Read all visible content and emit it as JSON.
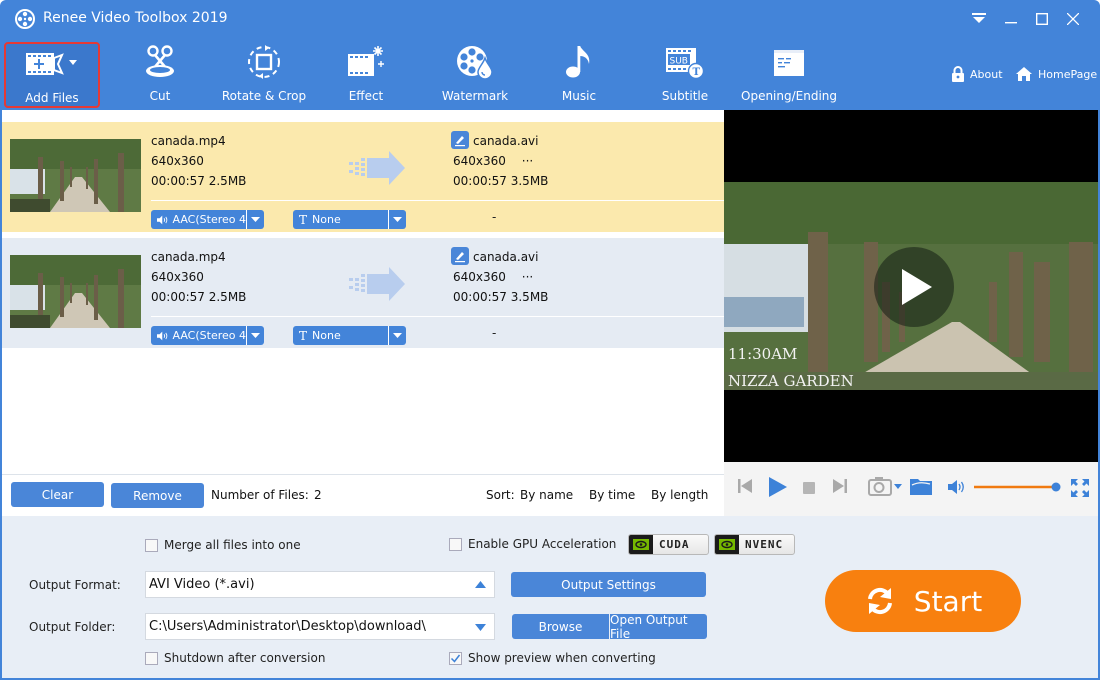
{
  "window": {
    "title": "Renee Video Toolbox 2019",
    "controls": [
      "menu",
      "minimize",
      "maximize",
      "close"
    ]
  },
  "toolbar": {
    "items": [
      {
        "label": "Add Files",
        "icon": "add-film-icon",
        "active": true
      },
      {
        "label": "Cut",
        "icon": "scissors-icon"
      },
      {
        "label": "Rotate & Crop",
        "icon": "rotate-crop-icon"
      },
      {
        "label": "Effect",
        "icon": "effect-film-icon"
      },
      {
        "label": "Watermark",
        "icon": "watermark-reel-icon"
      },
      {
        "label": "Music",
        "icon": "music-note-icon"
      },
      {
        "label": "Subtitle",
        "icon": "subtitle-icon"
      },
      {
        "label": "Opening/Ending",
        "icon": "opening-ending-icon"
      }
    ],
    "about_label": "About",
    "homepage_label": "HomePage"
  },
  "files": [
    {
      "source_name": "canada.mp4",
      "source_resolution": "640x360",
      "source_duration": "00:00:57",
      "source_size": "2.5MB",
      "output_name": "canada.avi",
      "output_resolution": "640x360",
      "output_more": "···",
      "output_duration": "00:00:57",
      "output_size": "3.5MB",
      "audio_track": "AAC(Stereo 4",
      "subtitle": "None",
      "extra": "-",
      "selected": true
    },
    {
      "source_name": "canada.mp4",
      "source_resolution": "640x360",
      "source_duration": "00:00:57",
      "source_size": "2.5MB",
      "output_name": "canada.avi",
      "output_resolution": "640x360",
      "output_more": "···",
      "output_duration": "00:00:57",
      "output_size": "3.5MB",
      "audio_track": "AAC(Stereo 4",
      "subtitle": "None",
      "extra": "-",
      "selected": false
    }
  ],
  "list_footer": {
    "clear_label": "Clear",
    "remove_label": "Remove",
    "count_label": "Number of Files:",
    "count_value": "2",
    "sort_label": "Sort:",
    "sort_options": [
      "By name",
      "By time",
      "By length"
    ]
  },
  "preview": {
    "overlay_time": "11:30AM",
    "overlay_place": "NIZZA GARDEN",
    "volume_fraction": 1.0
  },
  "settings": {
    "merge_label": "Merge all files into one",
    "merge_checked": false,
    "gpu_label": "Enable GPU Acceleration",
    "gpu_checked": false,
    "cuda_label": "CUDA",
    "nvenc_label": "NVENC",
    "format_label": "Output Format:",
    "format_value": "AVI Video (*.avi)",
    "output_settings_label": "Output Settings",
    "folder_label": "Output Folder:",
    "folder_value": "C:\\Users\\Administrator\\Desktop\\download\\",
    "browse_label": "Browse",
    "open_output_label": "Open Output File",
    "shutdown_label": "Shutdown after conversion",
    "shutdown_checked": false,
    "show_preview_label": "Show preview when converting",
    "show_preview_checked": true,
    "start_label": "Start"
  },
  "colors": {
    "brand_blue": "#4384d9",
    "selected_row": "#fbe9ad",
    "start_orange": "#f8800f",
    "volume_orange": "#f07a10",
    "highlight_red": "#e53935"
  }
}
